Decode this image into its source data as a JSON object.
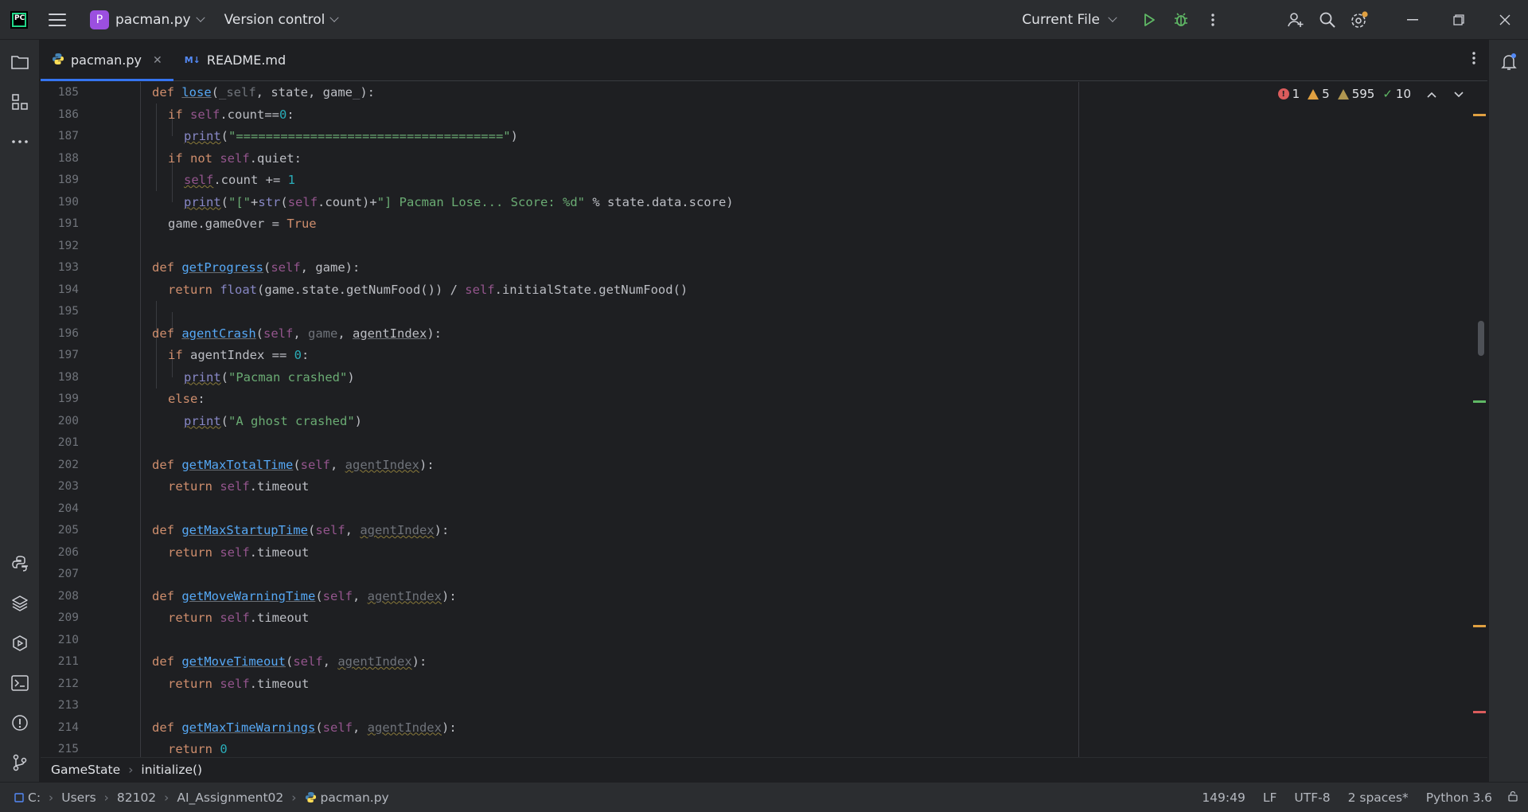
{
  "titlebar": {
    "project_badge": "P",
    "project_name": "pacman.py",
    "vcs_label": "Version control",
    "run_config": "Current File"
  },
  "tabs": [
    {
      "label": "pacman.py",
      "icon": "python-icon",
      "active": true
    },
    {
      "label": "README.md",
      "icon": "markdown-icon",
      "active": false
    }
  ],
  "inspections": {
    "errors": "1",
    "warnings": "5",
    "weak_warnings": "595",
    "ok": "10"
  },
  "editor": {
    "first_line": 185,
    "lines": [
      "185",
      "186",
      "187",
      "188",
      "189",
      "190",
      "191",
      "192",
      "193",
      "194",
      "195",
      "196",
      "197",
      "198",
      "199",
      "200",
      "201",
      "202",
      "203",
      "204",
      "205",
      "206",
      "207",
      "208",
      "209",
      "210",
      "211",
      "212",
      "213",
      "214",
      "215"
    ]
  },
  "breadcrumbs": [
    "GameState",
    "initialize()"
  ],
  "status": {
    "path": [
      "C:",
      "Users",
      "82102",
      "AI_Assignment02",
      "pacman.py"
    ],
    "position": "149:49",
    "line_sep": "LF",
    "encoding": "UTF-8",
    "indent": "2 spaces*",
    "interpreter": "Python 3.6"
  },
  "colors": {
    "accent": "#3574f0",
    "error": "#db5c5c",
    "warning": "#e0a041",
    "ok": "#5fb865"
  }
}
